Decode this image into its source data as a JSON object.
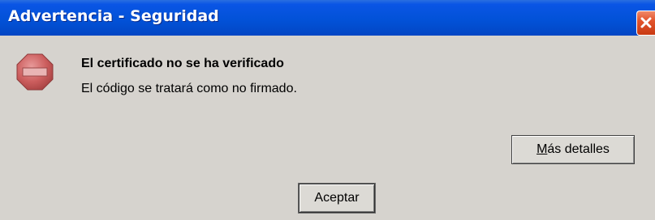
{
  "window": {
    "title": "Advertencia - Seguridad"
  },
  "dialog": {
    "icon": "stop-icon",
    "heading": "El certificado no se ha verificado",
    "message": "El código se tratará como no firmado.",
    "details_button": {
      "mnemonic": "M",
      "rest": "ás detalles"
    },
    "ok_button": "Aceptar"
  },
  "colors": {
    "titlebar": "#0252d8",
    "dialog_bg": "#d6d3ce",
    "stop_icon": "#c85a5a",
    "close_button": "#e2542c"
  }
}
